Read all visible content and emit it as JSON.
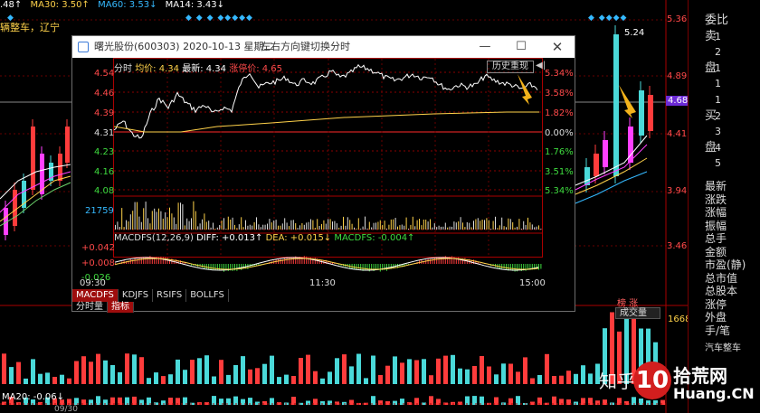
{
  "top_indicators": [
    {
      "text": ".48↑",
      "color": "#ffffff"
    },
    {
      "text": "MA30: 3.50↑",
      "color": "#ffd24a"
    },
    {
      "text": "MA60: 3.53↓",
      "color": "#35b9ff"
    },
    {
      "text": "MA14: 3.43↓",
      "color": "#ffffff"
    }
  ],
  "bg_annotation": "辆整车，辽宁",
  "bg_price_axis": [
    "5.36",
    "4.89",
    "4.68",
    "4.41",
    "3.94",
    "3.46"
  ],
  "bg_peak_label": "5.24",
  "bg_date_label": "09/30",
  "bottom_indicator": {
    "ma20": "MA20: -0.06↓"
  },
  "right_panel": {
    "rows": [
      {
        "label": "委比",
        "value": ""
      },
      {
        "label": "卖",
        "value": "1"
      },
      {
        "label": "",
        "value": "2"
      },
      {
        "label": "盘",
        "value": "1"
      },
      {
        "label": "",
        "value": "1"
      },
      {
        "label": "",
        "value": "1"
      },
      {
        "label": "买",
        "value": "2"
      },
      {
        "label": "",
        "value": "3"
      },
      {
        "label": "盘",
        "value": "4"
      },
      {
        "label": "",
        "value": "5"
      }
    ],
    "stats": [
      "最新",
      "涨跌",
      "涨幅",
      "振幅",
      "总手",
      "金额",
      "市盈(静)",
      "总市值",
      "总股本",
      "涨停",
      "外盘",
      "手/笔"
    ],
    "sector": "汽车整车",
    "vol_value": "16682"
  },
  "dialog": {
    "title": "曙光股份(600303)  2020-10-13 星期二",
    "hint": "左右方向键切换分时",
    "header_labels": {
      "mode": "分时",
      "avg": "均价: 4.34",
      "latest": "最新: 4.34",
      "limit": "涨停价: 4.65"
    },
    "history_button": "历史重现",
    "price_axis_left": [
      "4.54",
      "4.46",
      "4.39",
      "4.31",
      "4.23",
      "4.16",
      "4.08"
    ],
    "price_axis_right": [
      "5.34%",
      "3.58%",
      "1.82%",
      "0.00%",
      "1.76%",
      "3.51%",
      "5.34%"
    ],
    "volume_label": "21759",
    "macd_header": {
      "name": "MACDFS(12,26,9)",
      "diff": "DIFF: +0.013↑",
      "dea": "DEA: +0.015↓",
      "macdfs": "MACDFS: -0.004↑"
    },
    "macd_axis": [
      "+0.042",
      "+0.008",
      "-0.026"
    ],
    "time_axis": [
      "09:30",
      "11:30",
      "15:00"
    ],
    "indicator_tabs": [
      "MACDFS",
      "KDJFS",
      "RSIFS",
      "BOLLFS"
    ],
    "view_tabs": [
      "分时量",
      "指标"
    ]
  },
  "bg_buttons": {
    "vol_select": "成交量",
    "hot": "榜 涨"
  },
  "watermark": {
    "site": "拾荒网",
    "domain": "Huang.CN",
    "zh": "知乎"
  },
  "colors": {
    "up": "#ff3c3c",
    "down": "#4ad9d9",
    "avg": "#ffd24a",
    "accent": "#9e0d0d",
    "magenta": "#ff40ff"
  }
}
